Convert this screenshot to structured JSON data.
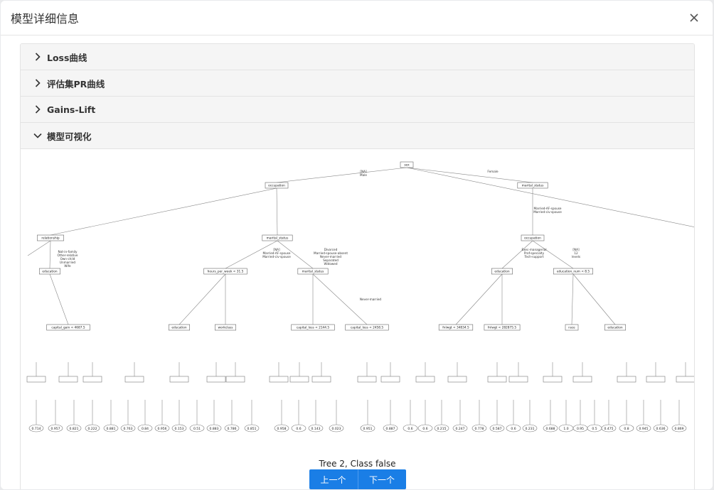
{
  "modal": {
    "title": "模型详细信息"
  },
  "panels": [
    {
      "label": "Loss曲线",
      "expanded": false
    },
    {
      "label": "评估集PR曲线",
      "expanded": false
    },
    {
      "label": "Gains-Lift",
      "expanded": false
    },
    {
      "label": "模型可视化",
      "expanded": true
    }
  ],
  "tree": {
    "caption": "Tree 2, Class false",
    "nodes": [
      "sex",
      "occupation",
      "marital_status",
      "relationship",
      "marital_status",
      "occupation",
      "education",
      "hours_per_week < 31.5",
      "marital_status",
      "education",
      "education_num < 8.5",
      "capital_gain < 4687.5",
      "education",
      "workclass",
      "capital_loss < 2144.5",
      "capital_loss < 2458.5",
      "fnlwgt < 34834.5",
      "fnlwgt < 282875.5",
      "race",
      "education"
    ],
    "edges": [
      "[NA] Male",
      "Female",
      "Married-AF-spouse Married-civ-spouse",
      "Not-in-family Other-relative Own-child Unmarried Wife",
      "[NA] Married-AF-spouse Married-civ-spouse",
      "Divorced Married-spouse-absent Never-married Separated Widowed",
      "Exec-managerial Prof-specialty Tech-support",
      "[NA] 12 levels",
      "Never-married"
    ],
    "leaves": [
      "0.714",
      "0.957",
      "0.821",
      "0.222",
      "0.881",
      "0.763",
      "0.84",
      "0.956",
      "0.153",
      "0.51",
      "0.883",
      "0.786",
      "0.851",
      "0.958",
      "0.6",
      "0.143",
      "0.023",
      "0.951",
      "0.887",
      "0.6",
      "0.6",
      "0.215",
      "0.247",
      "0.778",
      "0.587",
      "0.6",
      "0.231",
      "0.688",
      "1.0",
      "0.95",
      "0.5",
      "0.475",
      "0.8",
      "0.945",
      "0.636",
      "0.869"
    ]
  },
  "pager": {
    "prev_label": "上一个",
    "next_label": "下一个"
  }
}
